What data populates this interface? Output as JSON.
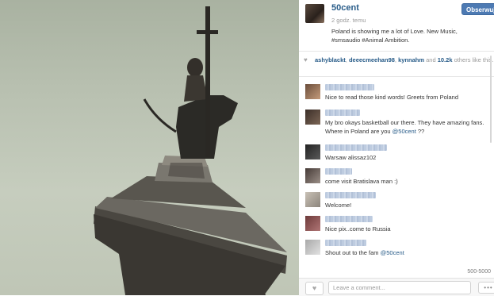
{
  "post": {
    "author": "50cent",
    "follow_label": "Obserwuj",
    "time": "2 godz. temu",
    "caption": "Poland is showing me a lot of Love. New Music, #smsaudio #Animal Ambition."
  },
  "likes": {
    "users": [
      "ashyblackt",
      "deeecmeehan98",
      "kynnahm"
    ],
    "and_text": "and",
    "count": "10.2k",
    "suffix": "others like this."
  },
  "comments": [
    {
      "text": "Nice to read those kind words! Greets from Poland",
      "mention": ""
    },
    {
      "text": "My bro okays basketball our there. They have amazing fans. Where in Poland are you",
      "mention": "@50cent",
      "after": "??"
    },
    {
      "text": "Warsaw alissaz102",
      "mention": ""
    },
    {
      "text": "come visit Bratislava man :)",
      "mention": ""
    },
    {
      "text": "Welcome!",
      "mention": ""
    },
    {
      "text": "Nice pix..come to Russia",
      "mention": ""
    },
    {
      "text": "Shout out to the fam",
      "mention": "@50cent"
    }
  ],
  "meta_right": "500-5000",
  "footer": {
    "comment_placeholder": "Leave a comment...",
    "more_label": "•••"
  },
  "colors": {
    "link": "#275b88",
    "follow_button": "#4d7ab3",
    "sky": "#b8c0b0"
  }
}
